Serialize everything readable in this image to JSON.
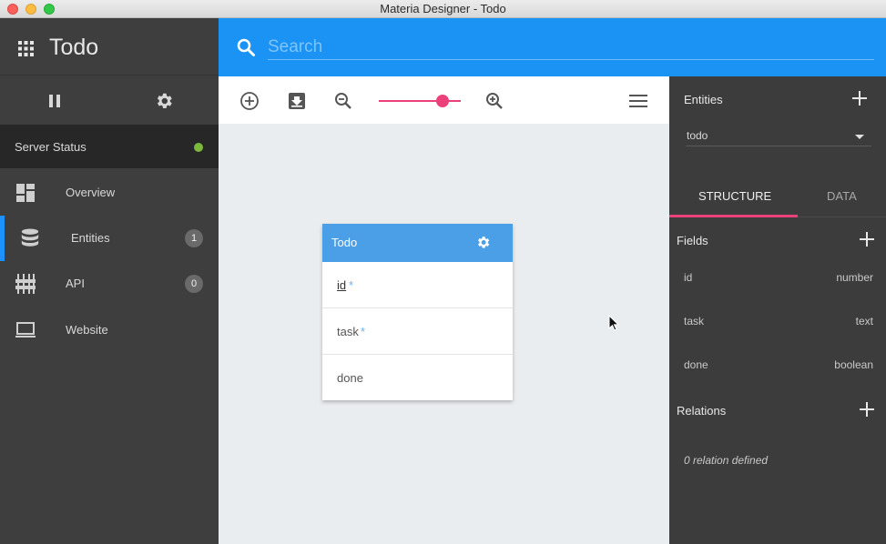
{
  "window": {
    "title": "Materia Designer - Todo"
  },
  "sidebar": {
    "app_title": "Todo",
    "server_status_label": "Server Status",
    "server_status_color": "#7cb83c",
    "items": [
      {
        "label": "Overview",
        "icon": "dashboard-icon"
      },
      {
        "label": "Entities",
        "icon": "database-icon",
        "badge": "1",
        "active": true
      },
      {
        "label": "API",
        "icon": "sliders-icon",
        "badge": "0"
      },
      {
        "label": "Website",
        "icon": "laptop-icon"
      }
    ]
  },
  "search": {
    "placeholder": "Search",
    "value": ""
  },
  "toolbar": {
    "icons": [
      "add-circle-icon",
      "import-icon",
      "zoom-out-icon",
      "zoom-in-icon",
      "menu-icon"
    ],
    "zoom_fraction": 0.78
  },
  "entity_card": {
    "name": "Todo",
    "fields": [
      {
        "name": "id",
        "required": "*",
        "key": true
      },
      {
        "name": "task",
        "required": "*"
      },
      {
        "name": "done",
        "required": ""
      }
    ]
  },
  "right_panel": {
    "entities_title": "Entities",
    "selected_entity": "todo",
    "tabs": {
      "structure": "STRUCTURE",
      "data": "DATA"
    },
    "fields_title": "Fields",
    "fields": [
      {
        "name": "id",
        "type": "number"
      },
      {
        "name": "task",
        "type": "text"
      },
      {
        "name": "done",
        "type": "boolean"
      }
    ],
    "relations_title": "Relations",
    "relations_empty": "0 relation defined"
  },
  "colors": {
    "accent": "#1a93f5",
    "pink": "#ec407a",
    "card_header": "#4a9fe6"
  }
}
